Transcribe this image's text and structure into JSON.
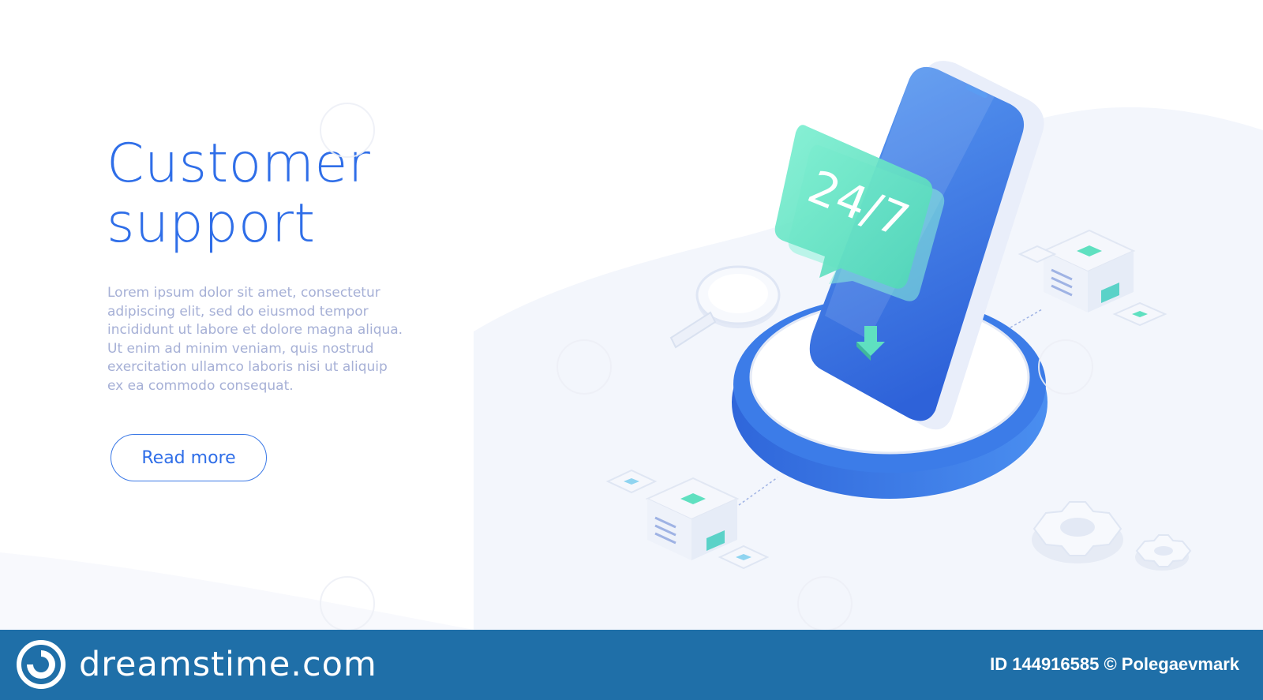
{
  "hero": {
    "title_line1": "Customer",
    "title_line2": "support",
    "body": "Lorem ipsum dolor sit amet, consectetur adipiscing elit, sed do eiusmod tempor incididunt ut labore et dolore magna aliqua. Ut enim ad minim veniam, quis nostrud exercitation ullamco laboris nisi ut aliquip ex ea commodo consequat.",
    "button_label": "Read more"
  },
  "illustration": {
    "chat_badge": "24/7",
    "watermark_text": "dreamstime"
  },
  "footer": {
    "brand": "dreamstime.com",
    "id_text": "ID 144916585 © Polegaevmark"
  },
  "colors": {
    "accent_blue": "#2f6ee8",
    "phone_blue": "#3f7fe6",
    "teal": "#5fe0c0",
    "footer_blue": "#1f6fa8",
    "body_text": "#a6b0d6"
  },
  "icons": [
    "magnifier-icon",
    "gear-icon",
    "download-arrow-icon",
    "server-block-icon",
    "dreamstime-logo-icon"
  ]
}
